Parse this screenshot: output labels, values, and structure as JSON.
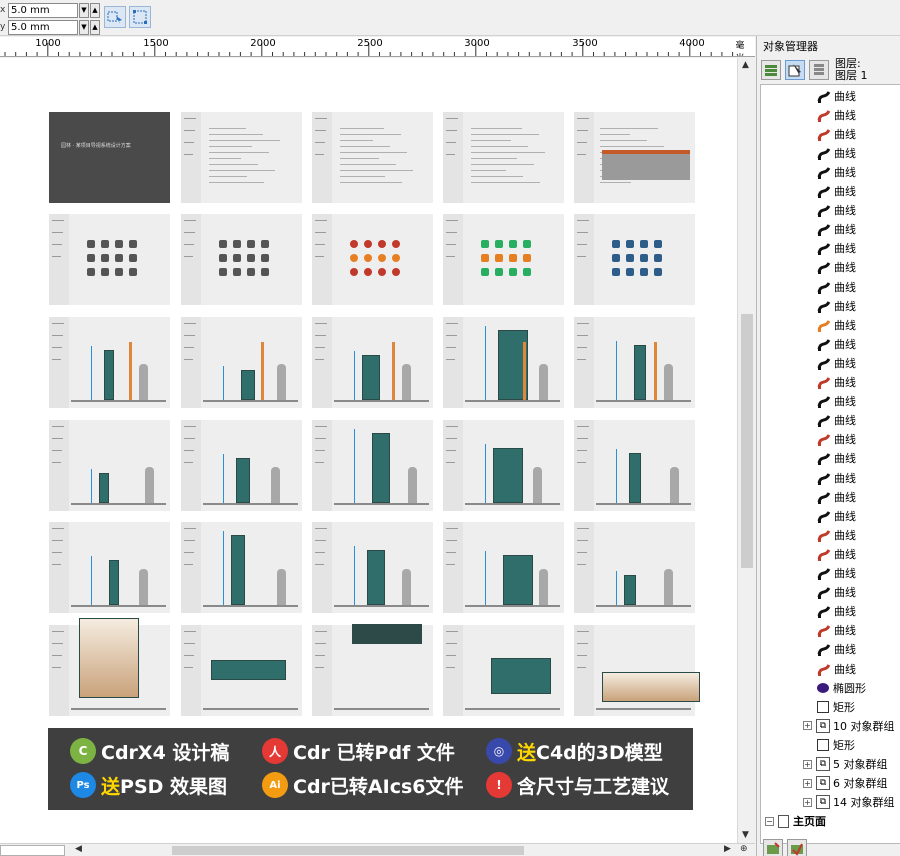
{
  "propbar": {
    "x_label": "x",
    "x_value": "5.0 mm",
    "y_label": "y",
    "y_value": "5.0 mm"
  },
  "ruler": {
    "labels": [
      "1000",
      "1500",
      "2000",
      "2500",
      "3000",
      "3500",
      "4000"
    ],
    "unit": "毫米"
  },
  "docker": {
    "title": "对象管理器",
    "layer_label_1": "图层:",
    "layer_label_2": "图层 1",
    "items": [
      {
        "type": "curve",
        "label": "曲线",
        "color": "#111111"
      },
      {
        "type": "curve",
        "label": "曲线",
        "color": "#c0392b"
      },
      {
        "type": "curve",
        "label": "曲线",
        "color": "#c0392b"
      },
      {
        "type": "curve",
        "label": "曲线",
        "color": "#111111"
      },
      {
        "type": "curve",
        "label": "曲线",
        "color": "#111111"
      },
      {
        "type": "curve",
        "label": "曲线",
        "color": "#111111"
      },
      {
        "type": "curve",
        "label": "曲线",
        "color": "#111111"
      },
      {
        "type": "curve",
        "label": "曲线",
        "color": "#111111"
      },
      {
        "type": "curve",
        "label": "曲线",
        "color": "#111111"
      },
      {
        "type": "curve",
        "label": "曲线",
        "color": "#111111"
      },
      {
        "type": "curve",
        "label": "曲线",
        "color": "#111111"
      },
      {
        "type": "curve",
        "label": "曲线",
        "color": "#111111"
      },
      {
        "type": "curve",
        "label": "曲线",
        "color": "#e67e22"
      },
      {
        "type": "curve",
        "label": "曲线",
        "color": "#111111"
      },
      {
        "type": "curve",
        "label": "曲线",
        "color": "#111111"
      },
      {
        "type": "curve",
        "label": "曲线",
        "color": "#c0392b"
      },
      {
        "type": "curve",
        "label": "曲线",
        "color": "#111111"
      },
      {
        "type": "curve",
        "label": "曲线",
        "color": "#111111"
      },
      {
        "type": "curve",
        "label": "曲线",
        "color": "#c0392b"
      },
      {
        "type": "curve",
        "label": "曲线",
        "color": "#111111"
      },
      {
        "type": "curve",
        "label": "曲线",
        "color": "#111111"
      },
      {
        "type": "curve",
        "label": "曲线",
        "color": "#111111"
      },
      {
        "type": "curve",
        "label": "曲线",
        "color": "#111111"
      },
      {
        "type": "curve",
        "label": "曲线",
        "color": "#c0392b"
      },
      {
        "type": "curve",
        "label": "曲线",
        "color": "#c0392b"
      },
      {
        "type": "curve",
        "label": "曲线",
        "color": "#111111"
      },
      {
        "type": "curve",
        "label": "曲线",
        "color": "#111111"
      },
      {
        "type": "curve",
        "label": "曲线",
        "color": "#111111"
      },
      {
        "type": "curve",
        "label": "曲线",
        "color": "#c0392b"
      },
      {
        "type": "curve",
        "label": "曲线",
        "color": "#111111"
      },
      {
        "type": "curve",
        "label": "曲线",
        "color": "#c0392b"
      },
      {
        "type": "ellipse",
        "label": "椭圆形"
      },
      {
        "type": "rect",
        "label": "矩形"
      },
      {
        "type": "group",
        "label": "10 对象群组"
      },
      {
        "type": "rect",
        "label": "矩形"
      },
      {
        "type": "group",
        "label": "5 对象群组"
      },
      {
        "type": "group",
        "label": "6 对象群组"
      },
      {
        "type": "group",
        "label": "14 对象群组"
      },
      {
        "type": "page",
        "label": "主页面"
      }
    ]
  },
  "canvas": {
    "cover_title": "园林 · 某项目导视系统设计方案",
    "banner": [
      {
        "icon": "corel-icon",
        "icon_color": "#7cb342",
        "icon_text": "C",
        "prefix": "",
        "text": "CdrX4 设计稿"
      },
      {
        "icon": "pdf-icon",
        "icon_color": "#e53935",
        "icon_text": "人",
        "prefix": "",
        "text": "Cdr 已转Pdf 文件"
      },
      {
        "icon": "cinema4d-icon",
        "icon_color": "#3949ab",
        "icon_text": "◎",
        "prefix": "送",
        "text": "C4d的3D模型"
      },
      {
        "icon": "photoshop-icon",
        "icon_color": "#1e88e5",
        "icon_text": "Ps",
        "prefix": "送",
        "text": "PSD 效果图"
      },
      {
        "icon": "illustrator-icon",
        "icon_color": "#f39c12",
        "icon_text": "Ai",
        "prefix": "",
        "text": "Cdr已转AIcs6文件"
      },
      {
        "icon": "warning-icon",
        "icon_color": "#e53935",
        "icon_text": "!",
        "prefix": "",
        "text": "含尺寸与工艺建议"
      }
    ]
  },
  "colors": {
    "teal": "#2f6e6a",
    "orange": "#e0863a",
    "blue_dim": "#2a8fd6",
    "banner_bg": "#3f3f3f",
    "highlight": "#ffd700"
  }
}
